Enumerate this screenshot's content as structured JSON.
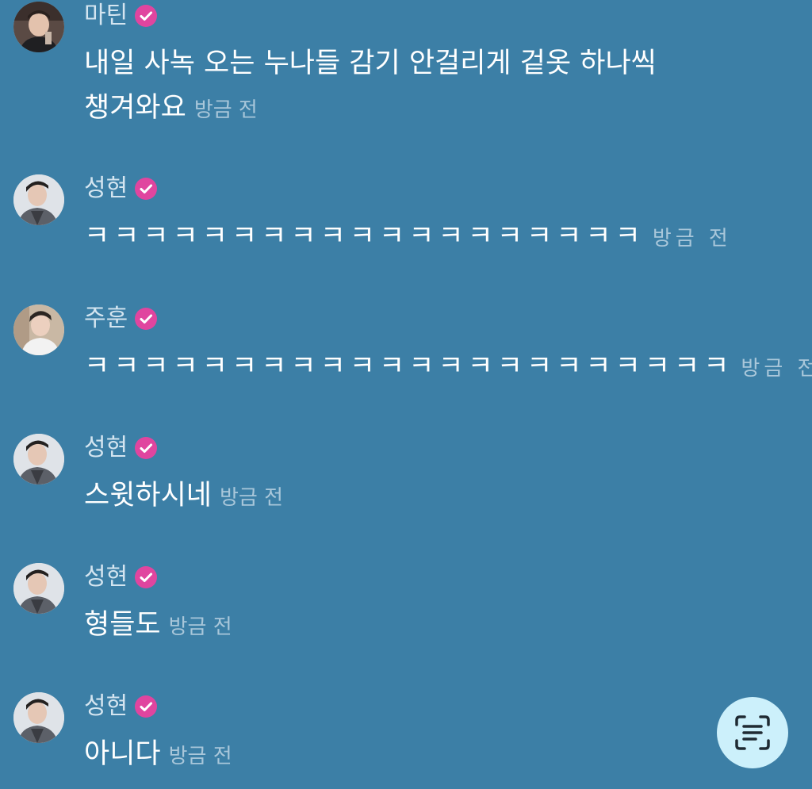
{
  "colors": {
    "background": "#3c7fa6",
    "verified_badge": "#e0459f",
    "scan_button": "#ccf0fb"
  },
  "messages": [
    {
      "name": "마틴",
      "verified": true,
      "text": "내일 사녹 오는 누나들 감기 안걸리게 겉옷 하나씩 챙겨와요",
      "time": "방금 전"
    },
    {
      "name": "성현",
      "verified": true,
      "text": "ㅋㅋㅋㅋㅋㅋㅋㅋㅋㅋㅋㅋㅋㅋㅋㅋㅋㅋㅋ",
      "time": "방금 전"
    },
    {
      "name": "주훈",
      "verified": true,
      "text": "ㅋㅋㅋㅋㅋㅋㅋㅋㅋㅋㅋㅋㅋㅋㅋㅋㅋㅋㅋㅋㅋㅋ",
      "time": "방금 전"
    },
    {
      "name": "성현",
      "verified": true,
      "text": "스윗하시네",
      "time": "방금 전"
    },
    {
      "name": "성현",
      "verified": true,
      "text": "형들도",
      "time": "방금 전"
    },
    {
      "name": "성현",
      "verified": true,
      "text": "아니다",
      "time": "방금 전"
    }
  ],
  "icons": {
    "verified": "check-badge-icon",
    "scan": "text-scan-icon"
  }
}
